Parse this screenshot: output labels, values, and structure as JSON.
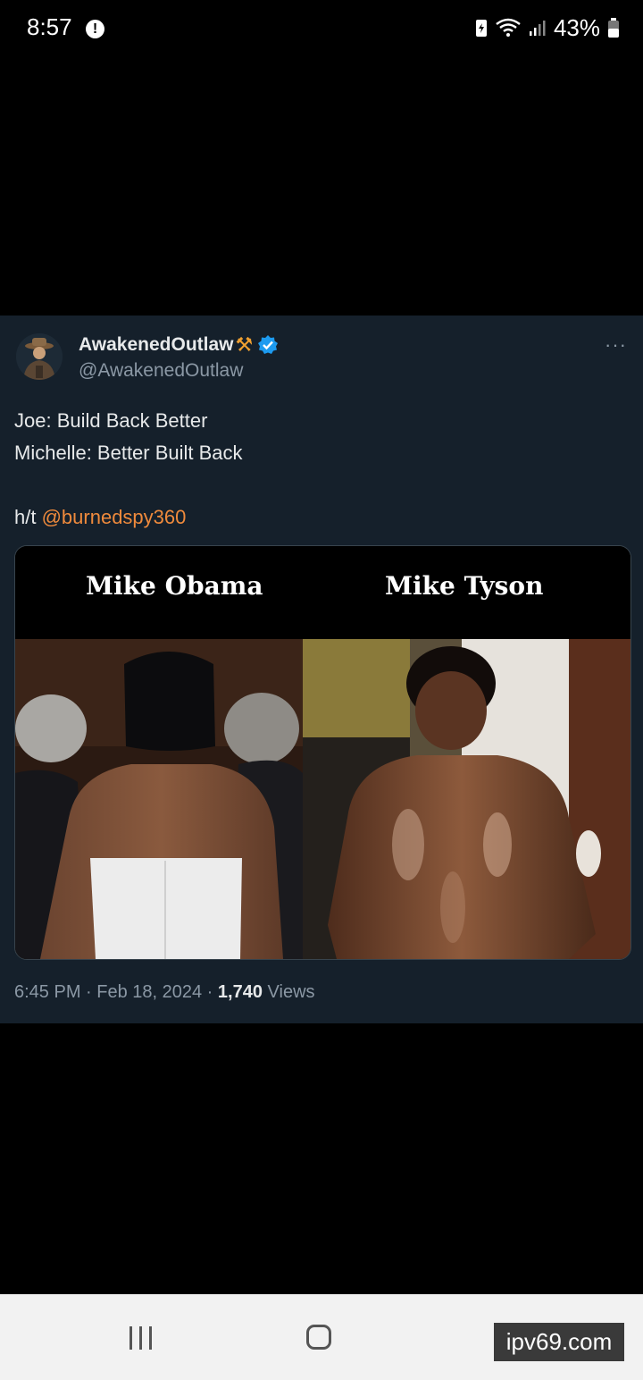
{
  "status_bar": {
    "time": "8:57",
    "alert_icon": "exclamation-circle-icon",
    "battery_percent": "43%",
    "icons": [
      "battery-saver-icon",
      "wifi-icon",
      "signal-icon",
      "battery-icon"
    ]
  },
  "tweet": {
    "display_name": "AwakenedOutlaw",
    "name_emoji": "⚒",
    "verified": true,
    "handle": "@AwakenedOutlaw",
    "more_label": "···",
    "lines": [
      "Joe: Build Back Better",
      "Michelle: Better Built Back",
      "",
      "h/t"
    ],
    "mention": "@burnedspy360",
    "media": {
      "caption_left": "Mike Obama",
      "caption_right": "Mike Tyson"
    },
    "timestamp": "6:45 PM · Feb 18, 2024 · ",
    "views_count": "1,740",
    "views_label": " Views"
  },
  "nav_bar": {
    "icons": [
      "recent-apps-icon",
      "home-icon",
      "back-icon"
    ]
  },
  "watermark": "ipv69.com",
  "colors": {
    "tweet_background": "#15202b",
    "mention": "#ef8a3c",
    "verified_badge": "#1d9bf0",
    "secondary_text": "#8b98a5"
  }
}
